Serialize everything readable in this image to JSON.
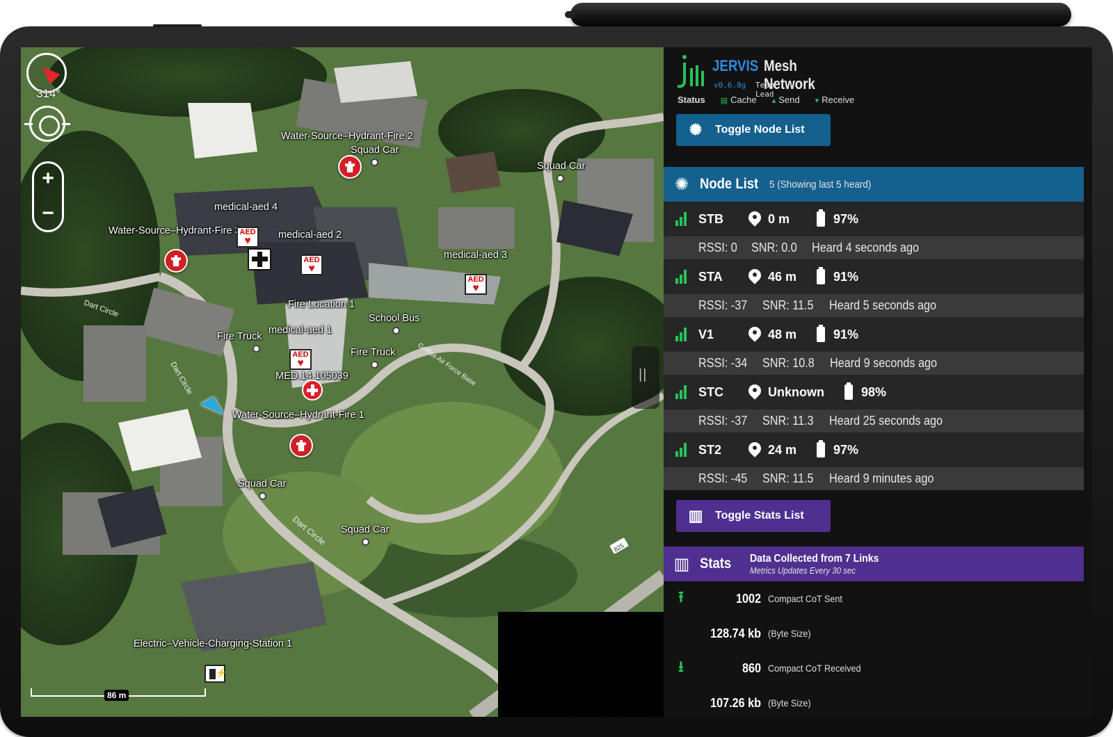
{
  "map": {
    "compass_heading": "314°",
    "scale_label": "86 m",
    "labels": [
      {
        "text": "Water-Source–Hydrant-Fire 2"
      },
      {
        "text": "Squad Car"
      },
      {
        "text": "Squad Car"
      },
      {
        "text": "medical-aed 4"
      },
      {
        "text": "Water-Source–Hydrant-Fire 3"
      },
      {
        "text": "medical-aed 2"
      },
      {
        "text": "medical-aed 3"
      },
      {
        "text": "Fire Location 1"
      },
      {
        "text": "School Bus"
      },
      {
        "text": "Fire Truck"
      },
      {
        "text": "medical-aed 1"
      },
      {
        "text": "Fire Truck"
      },
      {
        "text": "MED.14.105039"
      },
      {
        "text": "Water-Source–Hydrant-Fire 1"
      },
      {
        "text": "Squad Car"
      },
      {
        "text": "Squad Car"
      },
      {
        "text": "Electric–Vehicle-Charging-Station 1"
      }
    ],
    "road_labels": [
      "Dart Circle",
      "Dart Circle",
      "Dart Circle",
      "Griffiss Air Force Base",
      "825"
    ],
    "marker_glyphs": {
      "aed": "AED",
      "nurse": "NURSE"
    }
  },
  "panel": {
    "brand_name_1": "JERVIS",
    "brand_name_2": "Mesh Network",
    "version": "v0.6.8g",
    "role": "Team Lead",
    "status": {
      "status_label": "Status",
      "cache_label": "Cache",
      "send_label": "Send",
      "receive_label": "Receive"
    },
    "toggle_node_list": "Toggle Node List",
    "node_list": {
      "title": "Node List",
      "subtitle": "5 (Showing last 5 heard)",
      "nodes": [
        {
          "id": "STB",
          "distance": "0 m",
          "battery": "97%",
          "rssi": "RSSI: 0",
          "snr": "SNR: 0.0",
          "heard": "Heard 4 seconds ago"
        },
        {
          "id": "STA",
          "distance": "46 m",
          "battery": "91%",
          "rssi": "RSSI: -37",
          "snr": "SNR: 11.5",
          "heard": "Heard 5 seconds ago"
        },
        {
          "id": "V1",
          "distance": "48 m",
          "battery": "91%",
          "rssi": "RSSI: -34",
          "snr": "SNR: 10.8",
          "heard": "Heard 9 seconds ago"
        },
        {
          "id": "STC",
          "distance": "Unknown",
          "battery": "98%",
          "rssi": "RSSI: -37",
          "snr": "SNR: 11.3",
          "heard": "Heard 25 seconds ago"
        },
        {
          "id": "ST2",
          "distance": "24 m",
          "battery": "97%",
          "rssi": "RSSI: -45",
          "snr": "SNR: 11.5",
          "heard": "Heard 9 minutes ago"
        }
      ]
    },
    "toggle_stats_list": "Toggle Stats List",
    "stats": {
      "title": "Stats",
      "subtitle": "Data Collected from 7 Links",
      "subtitle2": "Metrics Updates Every 30 sec",
      "rows": [
        {
          "value": "1002",
          "desc": "Compact CoT Sent"
        },
        {
          "value": "128.74 kb",
          "desc": "(Byte Size)"
        },
        {
          "value": "860",
          "desc": "Compact CoT Received"
        },
        {
          "value": "107.26 kb",
          "desc": "(Byte Size)"
        }
      ]
    },
    "colors": {
      "node_blue": "#14608f",
      "stats_purple": "#4f2f8f",
      "signal_green": "#27c35a",
      "brand_blue": "#2e8bdc"
    }
  }
}
